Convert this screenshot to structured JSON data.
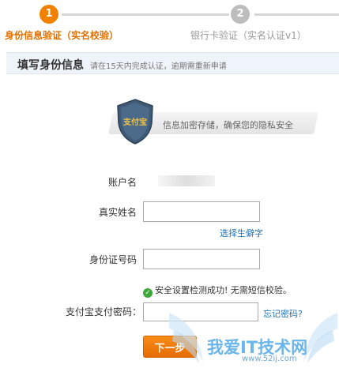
{
  "steps": [
    {
      "number": "1",
      "label": "身份信息验证（实名校验）"
    },
    {
      "number": "2",
      "label": "银行卡验证（实名认证v1）"
    }
  ],
  "section": {
    "title": "填写身份信息",
    "subtitle": "请在15天内完成认证，逾期需重新申请"
  },
  "security": {
    "shield_text": "支付宝",
    "banner_text": "信息加密存储，确保您的隐私安全"
  },
  "form": {
    "account_label": "账户名",
    "realname_label": "真实姓名",
    "realname_value": "",
    "rare_char_link": "选择生僻字",
    "idnum_label": "身份证号码",
    "idnum_value": "",
    "check_text": "安全设置检测成功! 无需短信校验。",
    "pwd_label": "支付宝支付密码：",
    "pwd_value": "",
    "forgot_link": "忘记密码?",
    "next_button": "下一步"
  },
  "watermark": {
    "text": "我爱IT技术网",
    "url": "www.52ij.com"
  },
  "colors": {
    "accent_orange": "#f08200",
    "link_blue": "#1e72b6",
    "success_green": "#3ea83a"
  }
}
